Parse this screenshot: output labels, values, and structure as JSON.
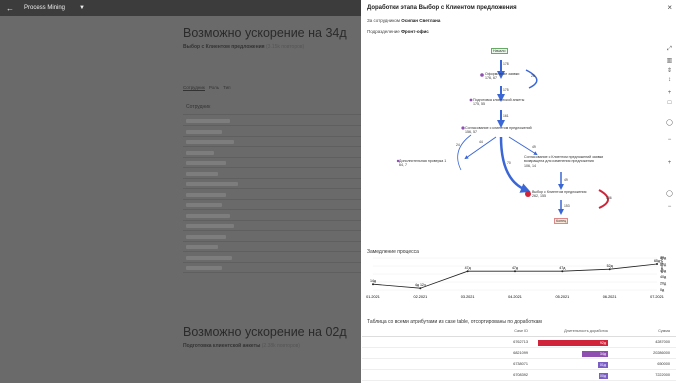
{
  "topbar": {
    "back_icon": "arrow-left-icon",
    "title": "Process Mining",
    "filter_icon": "filter-icon"
  },
  "left": {
    "section1": {
      "title": "Возможно ускорение на 34д",
      "subtitle_bold": "Выбор с Клиентом предложения",
      "subtitle_light": "(3.15k повторов)"
    },
    "tabs": [
      "Сотрудник",
      "Роль",
      "Тип"
    ],
    "column_header": "Сотрудник",
    "section2": {
      "title": "Возможно ускорение на 02д",
      "subtitle_bold": "Подготовка клиентской анкеты",
      "subtitle_light": "(2.38k повторов)"
    }
  },
  "panel": {
    "title": "Доработки этапа Выбор с Клиентом предложения",
    "employee_label": "За сотрудником",
    "employee_name": "Осипан Светлана",
    "dept_label": "Подразделение",
    "dept_name": "Фронт-офис",
    "process": {
      "start": "Начало",
      "end": "Конец",
      "nodes": [
        {
          "name": "Оформление заявки",
          "value": "176, 67"
        },
        {
          "name": "Подготовка клиентской анкеты",
          "value": "175, 55"
        },
        {
          "name": "Согласование с клиентом предложений",
          "value": "156, 57"
        },
        {
          "name": "Дополнительная проверка 1",
          "value": "64, 7"
        },
        {
          "name": "Согласование с Клиентом предложений заявки возвращена для изменения предложения",
          "value": "106, 14"
        },
        {
          "name": "Выбор с Клиентом предложения",
          "value": "262, 155"
        }
      ],
      "flows": [
        "178",
        "175",
        "161",
        "44",
        "24",
        "49",
        "70",
        "49",
        "153",
        "136",
        "26"
      ]
    },
    "slowdown": {
      "title": "Замедление процесса",
      "chart_data": {
        "type": "line",
        "x": [
          "01.2021",
          "02.2021",
          "03.2021",
          "04.2021",
          "05.2021",
          "06.2021",
          "07.2021"
        ],
        "values": [
          14.5,
          4.5,
          47,
          47,
          47,
          52,
          65
        ],
        "point_labels": [
          "14д",
          "4д 12ч",
          "47д",
          "47д",
          "47д",
          "52д",
          "65д"
        ],
        "y_ticks": [
          "0д",
          "20д",
          "40д",
          "40д",
          "60д",
          "80д"
        ],
        "ylabel": "Задержка",
        "ylim": [
          0,
          80
        ]
      }
    },
    "table": {
      "title": "Таблица со всеми атрибутами из case table, отсортированы по доработкам",
      "headers": [
        "Case ID",
        "Длительность доработок",
        "Сумма"
      ],
      "rows": [
        {
          "id": "6762713",
          "dur": "92д",
          "sum": "4287000",
          "color": "#d0243a",
          "frac": 1.0
        },
        {
          "id": "6821099",
          "dur": "34д",
          "sum": "20286000",
          "color": "#8e4fb0",
          "frac": 0.37
        },
        {
          "id": "6738071",
          "dur": "01д",
          "sum": "650000",
          "color": "#7a5ec4",
          "frac": 0.14
        },
        {
          "id": "6708392",
          "dur": "00д",
          "sum": "7222000",
          "color": "#7a5ec4",
          "frac": 0.13
        }
      ]
    }
  }
}
